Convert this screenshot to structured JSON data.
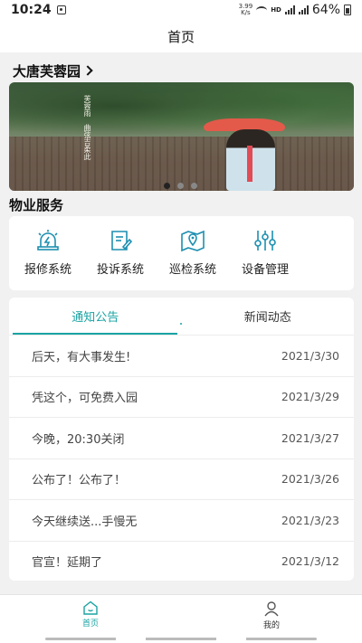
{
  "status_bar": {
    "time": "10:24",
    "speed_value": "3.99",
    "speed_unit": "K/s",
    "hd_label": "HD",
    "battery": "64%"
  },
  "nav": {
    "title": "首页"
  },
  "community": {
    "name": "大唐芙蓉园"
  },
  "banner": {
    "poem_lines": [
      "芙蓉雨",
      "曲弦吉柔此"
    ],
    "active_dot": 0,
    "dot_count": 3
  },
  "services": {
    "heading": "物业服务",
    "items": [
      {
        "label": "报修系统",
        "icon": "repair-alarm-icon"
      },
      {
        "label": "投诉系统",
        "icon": "complaint-document-icon"
      },
      {
        "label": "巡检系统",
        "icon": "patrol-map-icon"
      },
      {
        "label": "设备管理",
        "icon": "equipment-sliders-icon"
      }
    ]
  },
  "news": {
    "tabs": [
      {
        "label": "通知公告",
        "active": true
      },
      {
        "label": "新闻动态",
        "active": false
      }
    ],
    "items": [
      {
        "title": "后天，有大事发生!",
        "date": "2021/3/30"
      },
      {
        "title": "凭这个，可免费入园",
        "date": "2021/3/29"
      },
      {
        "title": "今晚，20:30关闭",
        "date": "2021/3/27"
      },
      {
        "title": "公布了！公布了！",
        "date": "2021/3/26"
      },
      {
        "title": "今天继续送...手慢无",
        "date": "2021/3/23"
      },
      {
        "title": "官宣！延期了",
        "date": "2021/3/12"
      }
    ]
  },
  "bottom_tabs": [
    {
      "label": "首页",
      "icon": "home-icon",
      "active": true
    },
    {
      "label": "我的",
      "icon": "user-icon",
      "active": false
    }
  ],
  "colors": {
    "accent": "#1aa3a3",
    "service_icon": "#1d8fb0"
  }
}
